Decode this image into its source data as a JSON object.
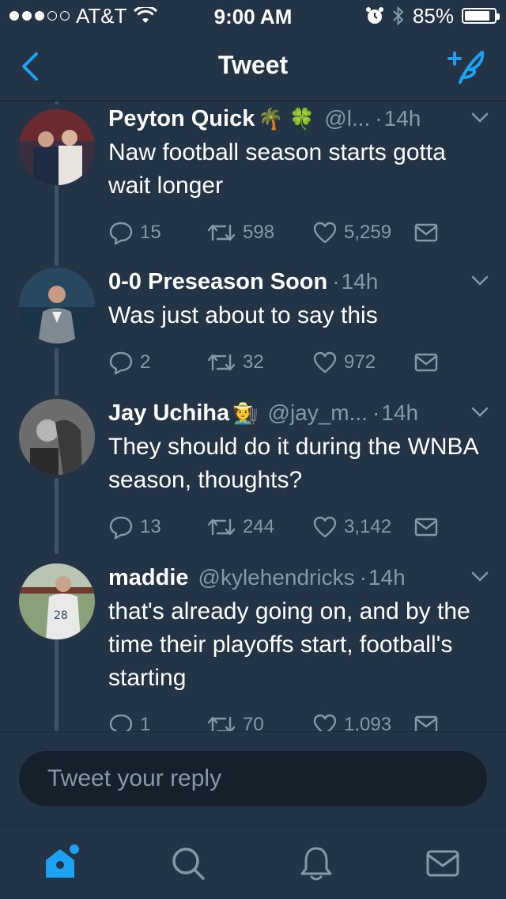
{
  "status_bar": {
    "carrier": "AT&T",
    "time": "9:00 AM",
    "battery_text": "85%",
    "battery_level": 0.85,
    "signal_bars": 3
  },
  "nav": {
    "title": "Tweet",
    "back_icon": "chevron-left-icon",
    "compose_icon": "compose-tweet-icon"
  },
  "colors": {
    "background": "#243447",
    "accent": "#1da1f2",
    "secondary_text": "#8899a6",
    "thread_line": "#3d5466"
  },
  "tweets": [
    {
      "name": "Peyton Quick",
      "name_emoji": "🌴 🍀",
      "handle": "@l...",
      "time": "14h",
      "text": "Naw football season starts gotta wait longer",
      "replies": "15",
      "retweets": "598",
      "likes": "5,259"
    },
    {
      "name": "0-0 Preseason Soon",
      "name_emoji": "",
      "handle": "",
      "time": "14h",
      "text": "Was just about to say this",
      "replies": "2",
      "retweets": "32",
      "likes": "972"
    },
    {
      "name": "Jay Uchiha",
      "name_emoji": "🧑‍🌾",
      "handle": "@jay_m...",
      "time": "14h",
      "text": "They should do it during the WNBA season, thoughts?",
      "replies": "13",
      "retweets": "244",
      "likes": "3,142"
    },
    {
      "name": "maddie",
      "name_emoji": "",
      "handle": "@kylehendricks",
      "time": "14h",
      "text": "that's already going on, and by the time their playoffs start, football's starting",
      "replies": "1",
      "retweets": "70",
      "likes": "1,093"
    }
  ],
  "reply": {
    "placeholder": "Tweet your reply"
  },
  "tab_bar": {
    "items": [
      "home-icon",
      "search-icon",
      "notifications-bell-icon",
      "messages-envelope-icon"
    ],
    "active": "home-icon"
  }
}
